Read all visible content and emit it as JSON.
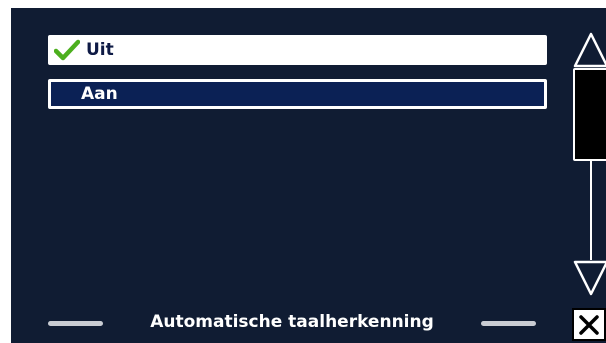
{
  "menu": {
    "options": [
      {
        "label": "Uit",
        "checked": true
      },
      {
        "label": "Aan",
        "checked": false
      }
    ]
  },
  "footer": {
    "title": "Automatische taalherkenning"
  },
  "icons": {
    "check": "checkmark-icon",
    "scroll_up": "triangle-up-icon",
    "scroll_down": "triangle-down-icon",
    "close": "close-icon"
  },
  "colors": {
    "background": "#101c33",
    "focus_fill": "#0b2155",
    "check_green": "#4caf1e"
  }
}
